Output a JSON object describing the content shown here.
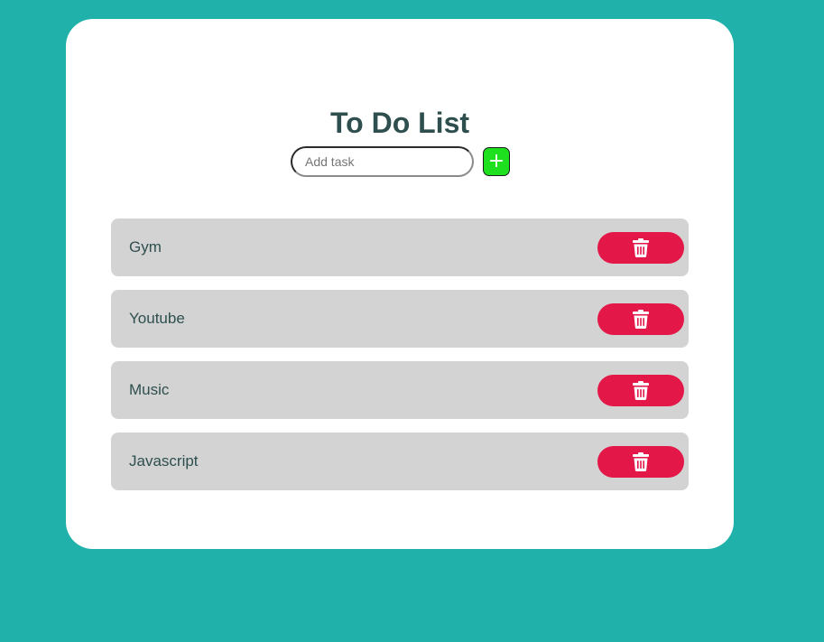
{
  "app": {
    "title": "To Do List"
  },
  "add_task": {
    "placeholder": "Add task",
    "value": "",
    "button_label": "+"
  },
  "tasks": [
    {
      "label": "Gym"
    },
    {
      "label": "Youtube"
    },
    {
      "label": "Music"
    },
    {
      "label": "Javascript"
    }
  ],
  "icons": {
    "add": "plus-icon",
    "delete": "trash-icon"
  },
  "colors": {
    "background": "#20b2aa",
    "card": "#ffffff",
    "title_text": "#2f4f4f",
    "item_background": "#d3d3d3",
    "delete_button": "#e31748",
    "add_button": "#1fe01f"
  }
}
